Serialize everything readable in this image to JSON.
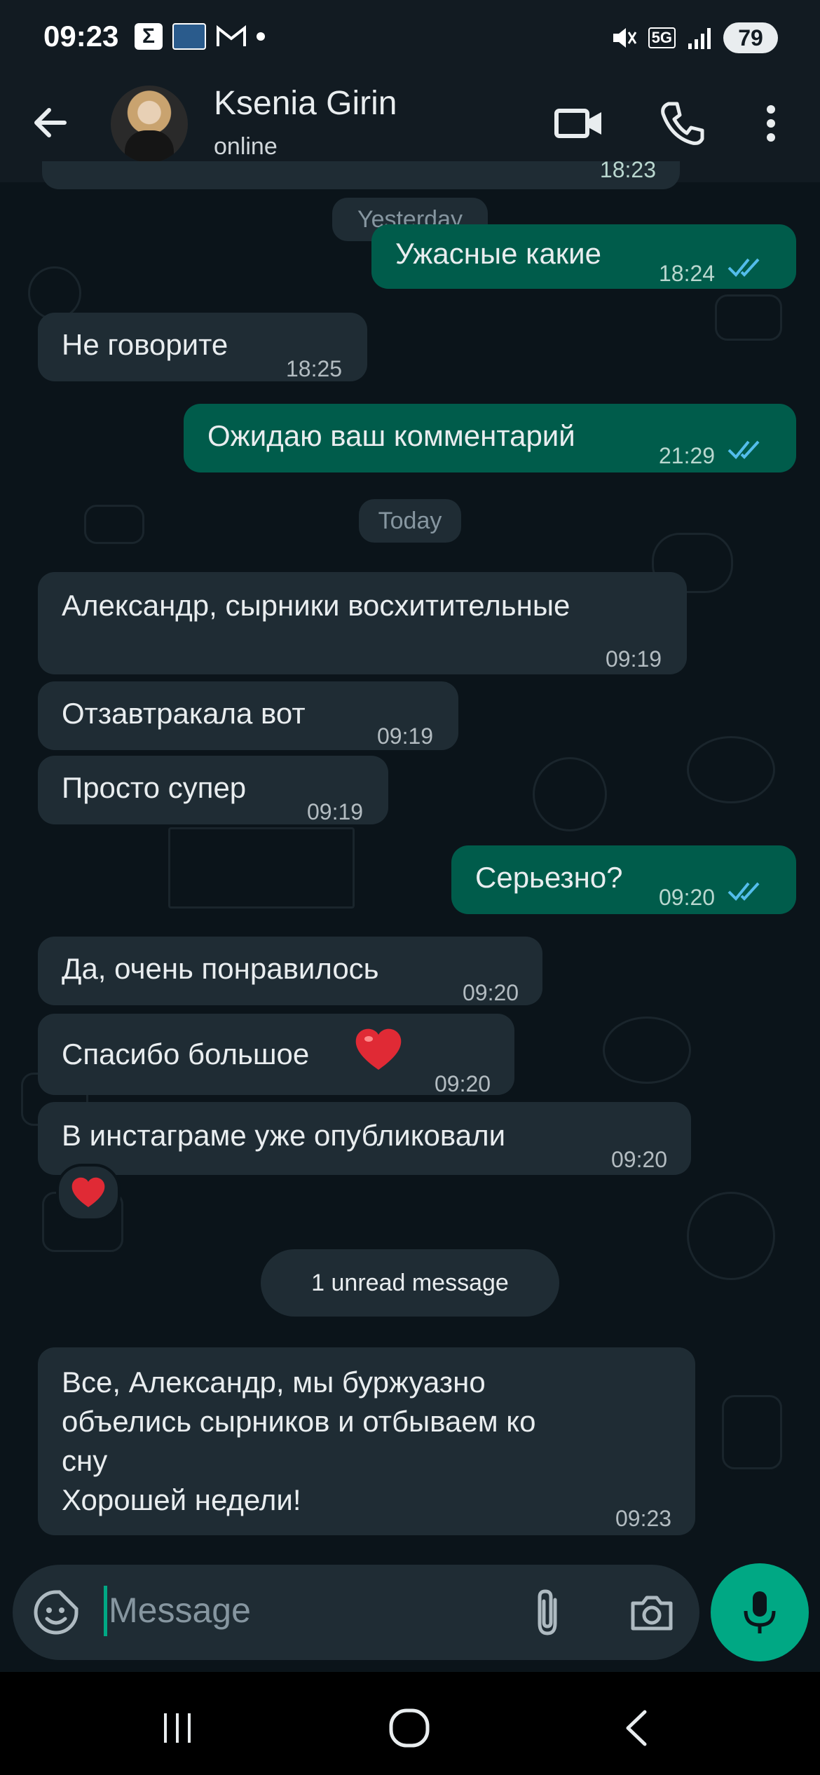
{
  "status_bar": {
    "time": "09:23",
    "network": "5G",
    "battery": "79"
  },
  "header": {
    "contact_name": "Ksenia Girin",
    "contact_status": "online"
  },
  "chat": {
    "date_yesterday": "Yesterday",
    "date_today": "Today",
    "unread_banner": "1 unread message",
    "messages": [
      {
        "text": "Ужасные какие",
        "time": "18:24"
      },
      {
        "text": "Не говорите",
        "time": "18:25"
      },
      {
        "text": "Ожидаю ваш комментарий",
        "time": "21:29"
      },
      {
        "text": "Александр, сырники восхитительные",
        "time": "09:19"
      },
      {
        "text": "Отзавтракала вот",
        "time": "09:19"
      },
      {
        "text": "Просто супер",
        "time": "09:19"
      },
      {
        "text": "Серьезно?",
        "time": "09:20"
      },
      {
        "text": "Да, очень понравилось",
        "time": "09:20"
      },
      {
        "text": "Спасибо большое",
        "time": "09:20"
      },
      {
        "text": "В инстаграме уже опубликовали",
        "time": "09:20"
      },
      {
        "text": "Все, Александр, мы буржуазно\nобъелись сырников и отбываем ко\nсну\nХорошей недели!",
        "time": "09:23"
      }
    ],
    "partial_time": "18:23"
  },
  "input": {
    "placeholder": "Message"
  },
  "colors": {
    "background": "#0b141a",
    "incoming_bubble": "#1f2c34",
    "outgoing_bubble": "#005c4b",
    "accent": "#00a884",
    "read_ticks": "#53bdeb"
  }
}
